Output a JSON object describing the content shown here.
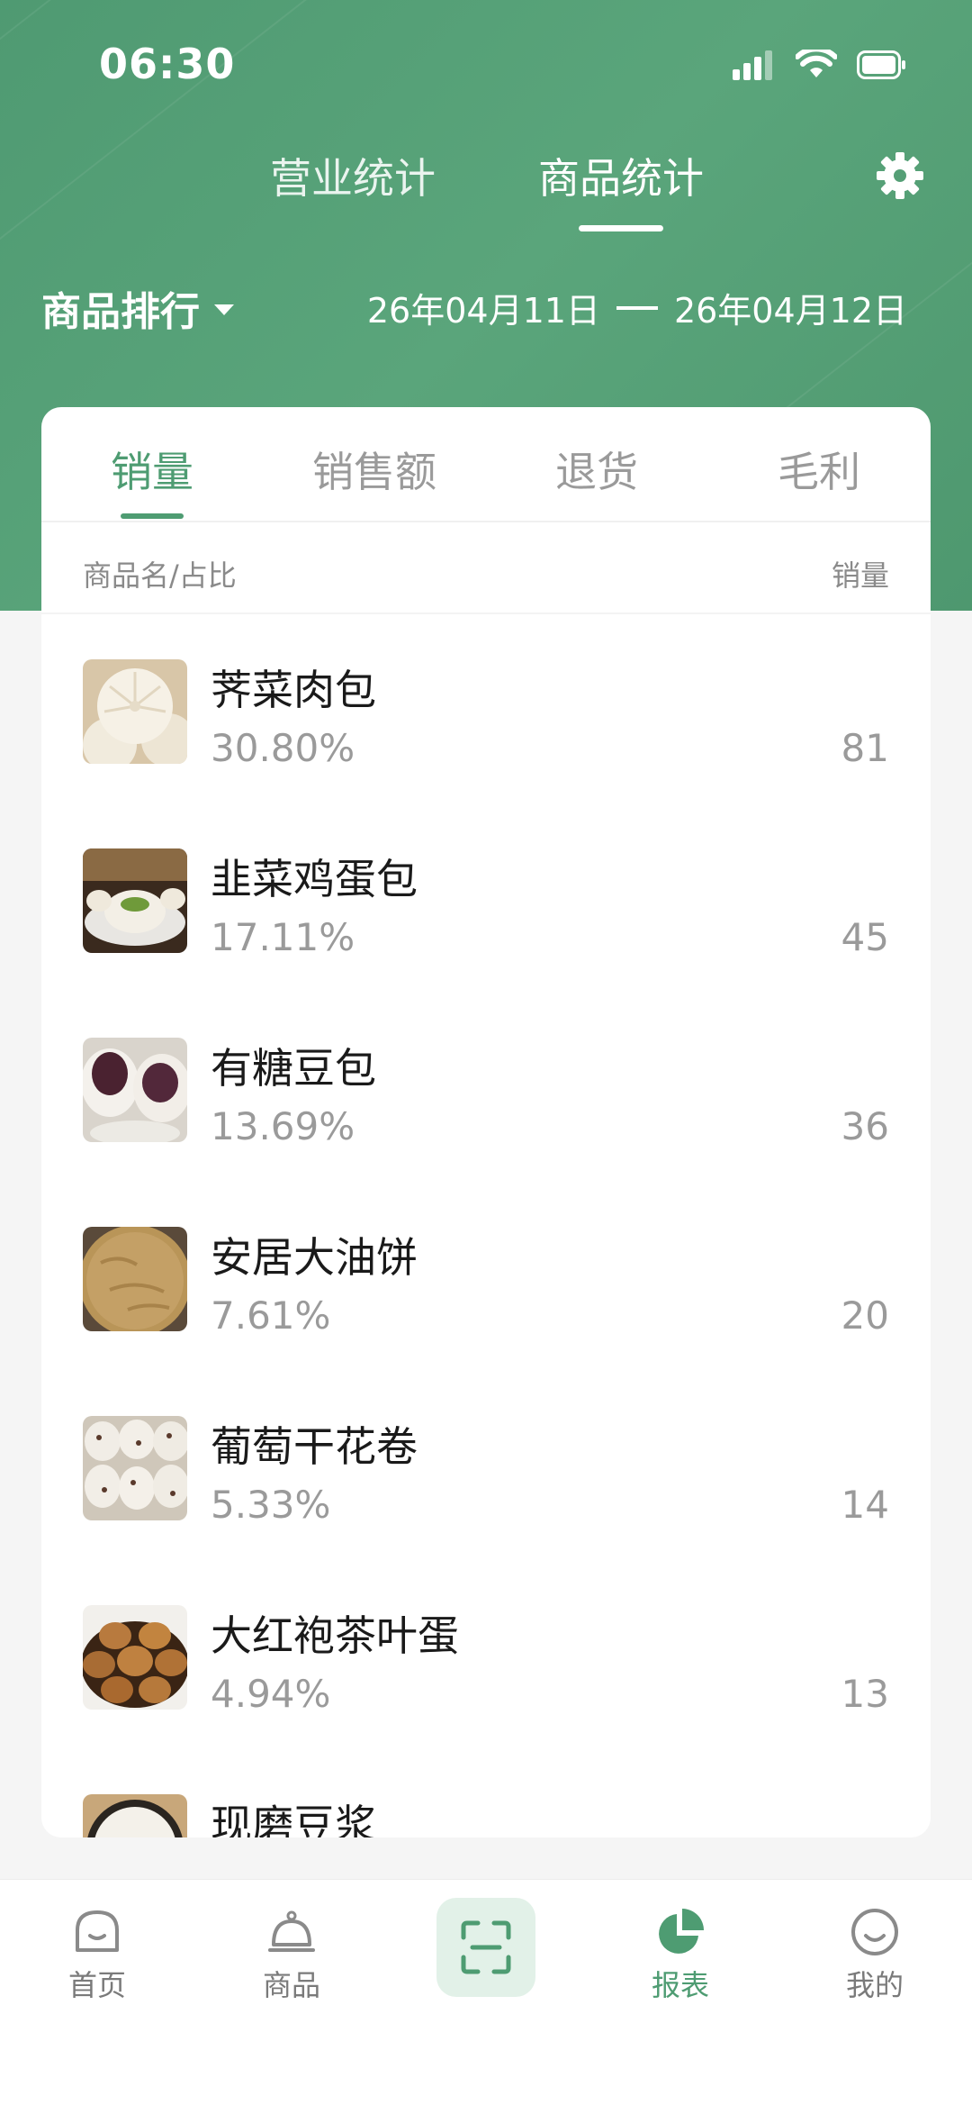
{
  "status_bar": {
    "time": "06:30"
  },
  "top_tabs": [
    {
      "label": "营业统计",
      "active": false
    },
    {
      "label": "商品统计",
      "active": true
    }
  ],
  "filter": {
    "rank_label": "商品排行",
    "date_start": "26年04月11日",
    "date_end": "26年04月12日"
  },
  "metric_tabs": [
    {
      "label": "销量",
      "active": true
    },
    {
      "label": "销售额",
      "active": false
    },
    {
      "label": "退货",
      "active": false
    },
    {
      "label": "毛利",
      "active": false
    }
  ],
  "list_header": {
    "name_col": "商品名/占比",
    "value_col": "销量"
  },
  "products": [
    {
      "name": "荠菜肉包",
      "percent": "30.80%",
      "qty": "81",
      "thumb": "meat-bun"
    },
    {
      "name": "韭菜鸡蛋包",
      "percent": "17.11%",
      "qty": "45",
      "thumb": "chive-bun"
    },
    {
      "name": "有糖豆包",
      "percent": "13.69%",
      "qty": "36",
      "thumb": "bean-bun"
    },
    {
      "name": "安居大油饼",
      "percent": "7.61%",
      "qty": "20",
      "thumb": "pancake"
    },
    {
      "name": "葡萄干花卷",
      "percent": "5.33%",
      "qty": "14",
      "thumb": "raisin-roll"
    },
    {
      "name": "大红袍茶叶蛋",
      "percent": "4.94%",
      "qty": "13",
      "thumb": "tea-egg"
    },
    {
      "name": "现磨豆浆",
      "percent": "",
      "qty": "",
      "thumb": "soy-milk"
    }
  ],
  "bottom_nav": [
    {
      "label": "首页",
      "icon": "home-icon",
      "active": false
    },
    {
      "label": "商品",
      "icon": "bell-icon",
      "active": false
    },
    {
      "label": "",
      "icon": "scan-icon",
      "active": false
    },
    {
      "label": "报表",
      "icon": "pie-chart-icon",
      "active": true
    },
    {
      "label": "我的",
      "icon": "smile-icon",
      "active": false
    }
  ],
  "colors": {
    "brand": "#4e9c72",
    "header_bg": "#559f76",
    "text_muted": "#9a9a9a"
  }
}
